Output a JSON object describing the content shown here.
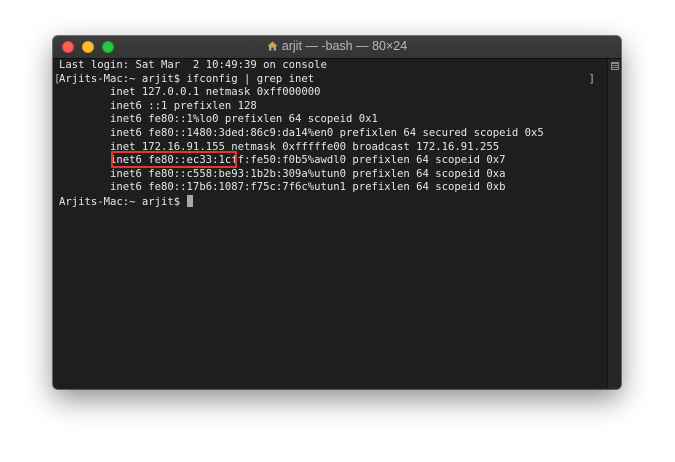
{
  "window": {
    "title": "arjit — -bash — 80×24",
    "icon": "home-icon"
  },
  "terminal": {
    "lines": [
      "Last login: Sat Mar  2 10:49:39 on console",
      "Arjits-Mac:~ arjit$ ifconfig | grep inet",
      "        inet 127.0.0.1 netmask 0xff000000",
      "        inet6 ::1 prefixlen 128",
      "        inet6 fe80::1%lo0 prefixlen 64 scopeid 0x1",
      "        inet6 fe80::1480:3ded:86c9:da14%en0 prefixlen 64 secured scopeid 0x5",
      "        inet 172.16.91.155 netmask 0xfffffe00 broadcast 172.16.91.255",
      "        inet6 fe80::ec33:1cff:fe50:f0b5%awdl0 prefixlen 64 scopeid 0x7",
      "        inet6 fe80::c558:be93:1b2b:309a%utun0 prefixlen 64 scopeid 0xa",
      "        inet6 fe80::17b6:1087:f75c:7f6c%utun1 prefixlen 64 scopeid 0xb"
    ],
    "prompt": "Arjits-Mac:~ arjit$ ",
    "bracket_left": "[",
    "bracket_right": "]"
  },
  "colors": {
    "highlight": "#e8352a",
    "background": "#1e1e1e",
    "text": "#e6e6e6"
  }
}
